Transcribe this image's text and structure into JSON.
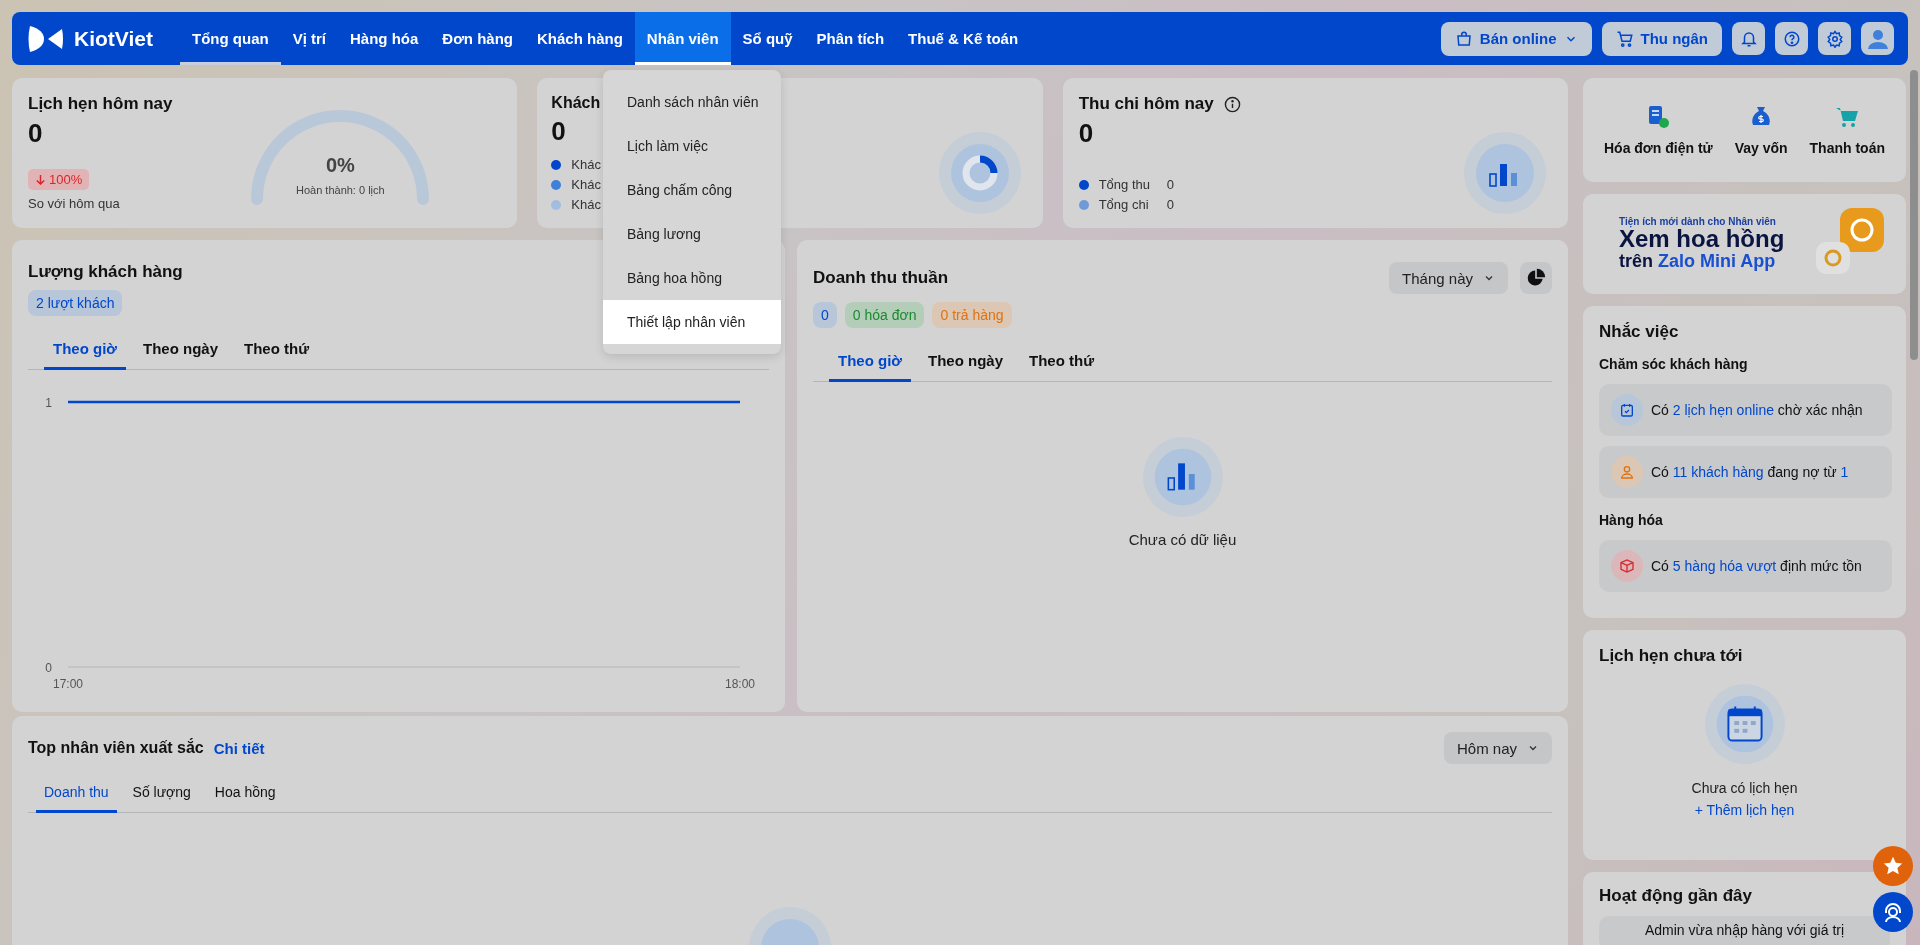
{
  "nav": {
    "brand": "KiotViet",
    "items": [
      {
        "label": "Tổng quan",
        "selected": true,
        "open": false
      },
      {
        "label": "Vị trí",
        "selected": false,
        "open": false
      },
      {
        "label": "Hàng hóa",
        "selected": false,
        "open": false
      },
      {
        "label": "Đơn hàng",
        "selected": false,
        "open": false
      },
      {
        "label": "Khách hàng",
        "selected": false,
        "open": false
      },
      {
        "label": "Nhân viên",
        "selected": false,
        "open": true
      },
      {
        "label": "Sổ quỹ",
        "selected": false,
        "open": false
      },
      {
        "label": "Phân tích",
        "selected": false,
        "open": false
      },
      {
        "label": "Thuế & Kế toán",
        "selected": false,
        "open": false
      }
    ],
    "online_button": "Bán online",
    "cashier_button": "Thu ngân"
  },
  "dropdown_menu": [
    {
      "label": "Danh sách nhân viên",
      "selected": false
    },
    {
      "label": "Lịch làm việc",
      "selected": false
    },
    {
      "label": "Bảng chấm công",
      "selected": false
    },
    {
      "label": "Bảng lương",
      "selected": false
    },
    {
      "label": "Bảng hoa hồng",
      "selected": false
    },
    {
      "label": "Thiết lập nhân viên",
      "selected": true
    }
  ],
  "appointments_today": {
    "title": "Lịch hẹn hôm nay",
    "value": "0",
    "change": "100%",
    "compare": "So với hôm qua",
    "gauge": {
      "percent": "0%",
      "caption": "Hoàn thành: 0 lịch"
    }
  },
  "customers_today": {
    "title": "Khách",
    "value": "0",
    "legend": [
      {
        "label": "Khác",
        "color": "#0047cc"
      },
      {
        "label": "Khác",
        "color": "#3f80da"
      },
      {
        "label": "Khác",
        "color": "#a3bde0"
      }
    ]
  },
  "cashflow_today": {
    "title": "Thu chi hôm nay",
    "value": "0",
    "legend": [
      {
        "label": "Tổng thu",
        "amount": "0",
        "color": "#0047cc"
      },
      {
        "label": "Tổng chi",
        "amount": "0",
        "color": "#6f9ad8"
      }
    ]
  },
  "customer_traffic": {
    "title": "Lượng khách hàng",
    "badge": "2 lượt khách",
    "tabs": [
      {
        "label": "Theo giờ",
        "selected": true
      },
      {
        "label": "Theo ngày",
        "selected": false
      },
      {
        "label": "Theo thứ",
        "selected": false
      }
    ],
    "chart_data": {
      "type": "line",
      "x": [
        "17:00",
        "18:00"
      ],
      "series": [
        {
          "color": "#0047cc",
          "values": [
            1,
            1
          ]
        }
      ],
      "ylim": [
        0,
        1
      ],
      "yticks": [
        0,
        1
      ]
    }
  },
  "net_revenue": {
    "title": "Doanh thu thuần",
    "period": "Tháng này",
    "pills": [
      {
        "label": "0",
        "kind": "amount"
      },
      {
        "label": "0 hóa đơn",
        "kind": "invoices"
      },
      {
        "label": "0 trả hàng",
        "kind": "returns"
      }
    ],
    "tabs": [
      {
        "label": "Theo giờ",
        "selected": true
      },
      {
        "label": "Theo ngày",
        "selected": false
      },
      {
        "label": "Theo thứ",
        "selected": false
      }
    ],
    "empty": "Chưa có dữ liệu"
  },
  "top_staff": {
    "title": "Top nhân viên xuất sắc",
    "link": "Chi tiết",
    "period": "Hôm nay",
    "tabs": [
      {
        "label": "Doanh thu",
        "selected": true
      },
      {
        "label": "Số lượng",
        "selected": false
      },
      {
        "label": "Hoa hồng",
        "selected": false
      }
    ]
  },
  "quick_links": [
    {
      "label": "Hóa đơn điện tử",
      "kind": "invoice"
    },
    {
      "label": "Vay vốn",
      "kind": "loan"
    },
    {
      "label": "Thanh toán",
      "kind": "payment"
    }
  ],
  "banner": {
    "tagline": "Tiện ích mới dành cho Nhân viên",
    "headline": "Xem hoa hồng",
    "subline": [
      {
        "text": "trên ",
        "kind": "plain"
      },
      {
        "text": "Zalo Mini App",
        "kind": "highlight"
      }
    ]
  },
  "reminders": {
    "title": "Nhắc việc",
    "groups": [
      {
        "title": "Chăm sóc khách hàng",
        "items": [
          {
            "kind": "calendar",
            "parts": [
              {
                "text": "Có ",
                "kind": "plain"
              },
              {
                "text": "2 lịch hẹn online",
                "kind": "link"
              },
              {
                "text": " chờ xác nhận",
                "kind": "plain"
              }
            ]
          },
          {
            "kind": "person",
            "parts": [
              {
                "text": "Có ",
                "kind": "plain"
              },
              {
                "text": "11 khách hàng",
                "kind": "link"
              },
              {
                "text": " đang nợ từ ",
                "kind": "plain"
              },
              {
                "text": "1",
                "kind": "link"
              }
            ]
          }
        ]
      },
      {
        "title": "Hàng hóa",
        "items": [
          {
            "kind": "box",
            "parts": [
              {
                "text": "Có ",
                "kind": "plain"
              },
              {
                "text": "5 hàng hóa vượt",
                "kind": "link"
              },
              {
                "text": " định mức tồn",
                "kind": "plain"
              }
            ]
          }
        ]
      }
    ]
  },
  "upcoming_appointments": {
    "title": "Lịch hẹn chưa tới",
    "empty": "Chưa có lịch hẹn",
    "add": "+ Thêm lịch hẹn"
  },
  "recent_activity": {
    "title": "Hoạt động gần đây",
    "entry": "Admin vừa nhập hàng với giá trị"
  }
}
